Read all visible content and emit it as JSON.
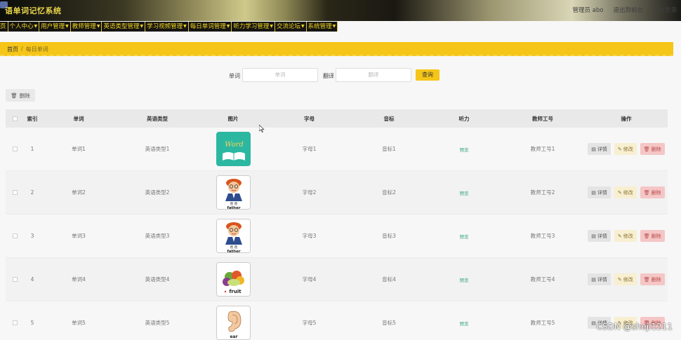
{
  "header": {
    "title": "语单词记忆系统",
    "admin": "管理员 abo",
    "logout": "退出到前台",
    "exit": "退出登录"
  },
  "nav": [
    {
      "label": "页"
    },
    {
      "label": "个人中心"
    },
    {
      "label": "用户管理"
    },
    {
      "label": "教师管理"
    },
    {
      "label": "英语类型管理"
    },
    {
      "label": "学习视频管理"
    },
    {
      "label": "每日单词管理"
    },
    {
      "label": "听力学习管理"
    },
    {
      "label": "交流论坛"
    },
    {
      "label": "系统管理"
    }
  ],
  "breadcrumb": {
    "home": "首页",
    "sep": "/",
    "current": "每日单词"
  },
  "search": {
    "word_label": "单词",
    "word_placeholder": "单词",
    "translate_label": "翻译",
    "translate_placeholder": "翻译",
    "query_button": "查询"
  },
  "toolbar": {
    "delete_label": "删除"
  },
  "table": {
    "headers": [
      "索引",
      "单词",
      "英语类型",
      "图片",
      "字母",
      "音标",
      "听力",
      "教师工号",
      "操作"
    ],
    "rows": [
      {
        "index": "1",
        "word": "单词1",
        "type": "英语类型1",
        "image": "word-book",
        "letter": "字母1",
        "phonetic": "音标1",
        "listen": "预览",
        "teacher": "教师工号1"
      },
      {
        "index": "2",
        "word": "单词2",
        "type": "英语类型2",
        "image": "father",
        "letter": "字母2",
        "phonetic": "音标2",
        "listen": "预览",
        "teacher": "教师工号2"
      },
      {
        "index": "3",
        "word": "单词3",
        "type": "英语类型3",
        "image": "father",
        "letter": "字母3",
        "phonetic": "音标3",
        "listen": "预览",
        "teacher": "教师工号3"
      },
      {
        "index": "4",
        "word": "单词4",
        "type": "英语类型4",
        "image": "fruit",
        "letter": "字母4",
        "phonetic": "音标4",
        "listen": "预览",
        "teacher": "教师工号4"
      },
      {
        "index": "5",
        "word": "单词5",
        "type": "英语类型5",
        "image": "ear",
        "letter": "字母5",
        "phonetic": "音标5",
        "listen": "预览",
        "teacher": "教师工号5"
      }
    ],
    "actions": {
      "detail": "详情",
      "edit": "修改",
      "delete": "删除"
    }
  },
  "images": {
    "word_book_text": "Word",
    "father_caption_cn": "爸 爸",
    "father_caption_en": "father",
    "fruit_caption": "fruit",
    "ear_caption": "ear"
  },
  "watermark": "CSDN @sheji1211",
  "colors": {
    "accent": "#f5c518",
    "nav_bg": "#161512",
    "link": "#3aa77a",
    "delete": "#f5c6c6",
    "edit": "#f7efd0"
  }
}
